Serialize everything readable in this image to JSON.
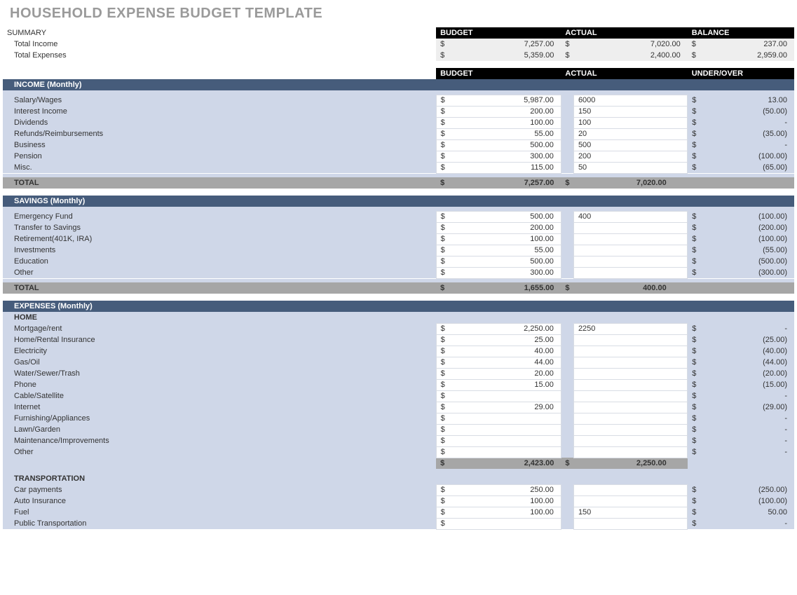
{
  "title": "HOUSEHOLD EXPENSE BUDGET TEMPLATE",
  "summary": {
    "label": "SUMMARY",
    "hdr_budget": "BUDGET",
    "hdr_actual": "ACTUAL",
    "hdr_balance": "BALANCE",
    "rows": [
      {
        "label": "Total Income",
        "budget": "7,257.00",
        "actual": "7,020.00",
        "balance": "237.00"
      },
      {
        "label": "Total Expenses",
        "budget": "5,359.00",
        "actual": "2,400.00",
        "balance": "2,959.00"
      }
    ]
  },
  "hdr2": {
    "budget": "BUDGET",
    "actual": "ACTUAL",
    "uo": "UNDER/OVER"
  },
  "income": {
    "title": "INCOME (Monthly)",
    "rows": [
      {
        "label": "Salary/Wages",
        "budget": "5,987.00",
        "actual": "6000",
        "uo": "13.00"
      },
      {
        "label": "Interest Income",
        "budget": "200.00",
        "actual": "150",
        "uo": "(50.00)"
      },
      {
        "label": "Dividends",
        "budget": "100.00",
        "actual": "100",
        "uo": "-"
      },
      {
        "label": "Refunds/Reimbursements",
        "budget": "55.00",
        "actual": "20",
        "uo": "(35.00)"
      },
      {
        "label": "Business",
        "budget": "500.00",
        "actual": "500",
        "uo": "-"
      },
      {
        "label": "Pension",
        "budget": "300.00",
        "actual": "200",
        "uo": "(100.00)"
      },
      {
        "label": "Misc.",
        "budget": "115.00",
        "actual": "50",
        "uo": "(65.00)"
      }
    ],
    "total_label": "TOTAL",
    "total_budget": "7,257.00",
    "total_actual": "7,020.00"
  },
  "savings": {
    "title": "SAVINGS (Monthly)",
    "rows": [
      {
        "label": "Emergency Fund",
        "budget": "500.00",
        "actual": "400",
        "uo": "(100.00)"
      },
      {
        "label": "Transfer to Savings",
        "budget": "200.00",
        "actual": "",
        "uo": "(200.00)"
      },
      {
        "label": "Retirement(401K, IRA)",
        "budget": "100.00",
        "actual": "",
        "uo": "(100.00)"
      },
      {
        "label": "Investments",
        "budget": "55.00",
        "actual": "",
        "uo": "(55.00)"
      },
      {
        "label": "Education",
        "budget": "500.00",
        "actual": "",
        "uo": "(500.00)"
      },
      {
        "label": "Other",
        "budget": "300.00",
        "actual": "",
        "uo": "(300.00)"
      }
    ],
    "total_label": "TOTAL",
    "total_budget": "1,655.00",
    "total_actual": "400.00"
  },
  "expenses": {
    "title": "EXPENSES (Monthly)",
    "home": {
      "header": "HOME",
      "rows": [
        {
          "label": "Mortgage/rent",
          "budget": "2,250.00",
          "actual": "2250",
          "uo": "-"
        },
        {
          "label": "Home/Rental Insurance",
          "budget": "25.00",
          "actual": "",
          "uo": "(25.00)"
        },
        {
          "label": "Electricity",
          "budget": "40.00",
          "actual": "",
          "uo": "(40.00)"
        },
        {
          "label": "Gas/Oil",
          "budget": "44.00",
          "actual": "",
          "uo": "(44.00)"
        },
        {
          "label": "Water/Sewer/Trash",
          "budget": "20.00",
          "actual": "",
          "uo": "(20.00)"
        },
        {
          "label": "Phone",
          "budget": "15.00",
          "actual": "",
          "uo": "(15.00)"
        },
        {
          "label": "Cable/Satellite",
          "budget": "",
          "actual": "",
          "uo": "-"
        },
        {
          "label": "Internet",
          "budget": "29.00",
          "actual": "",
          "uo": "(29.00)"
        },
        {
          "label": "Furnishing/Appliances",
          "budget": "",
          "actual": "",
          "uo": "-"
        },
        {
          "label": "Lawn/Garden",
          "budget": "",
          "actual": "",
          "uo": "-"
        },
        {
          "label": "Maintenance/Improvements",
          "budget": "",
          "actual": "",
          "uo": "-"
        },
        {
          "label": "Other",
          "budget": "",
          "actual": "",
          "uo": "-"
        }
      ],
      "subtotal_budget": "2,423.00",
      "subtotal_actual": "2,250.00"
    },
    "transport": {
      "header": "TRANSPORTATION",
      "rows": [
        {
          "label": "Car payments",
          "budget": "250.00",
          "actual": "",
          "uo": "(250.00)"
        },
        {
          "label": "Auto Insurance",
          "budget": "100.00",
          "actual": "",
          "uo": "(100.00)"
        },
        {
          "label": "Fuel",
          "budget": "100.00",
          "actual": "150",
          "uo": "50.00"
        },
        {
          "label": "Public Transportation",
          "budget": "",
          "actual": "",
          "uo": "-"
        }
      ]
    }
  },
  "sym": "$"
}
